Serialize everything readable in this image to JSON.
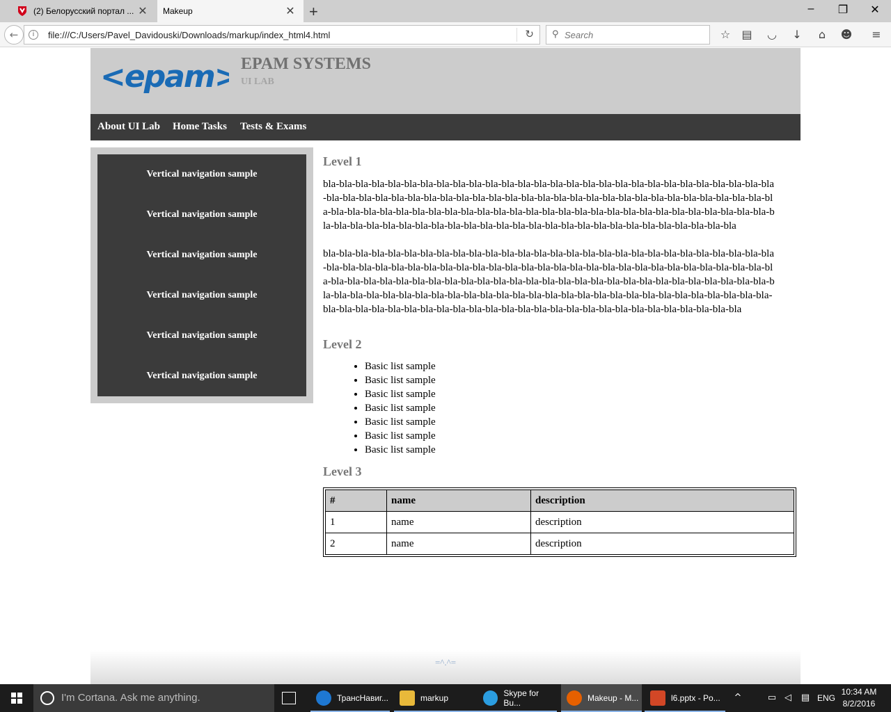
{
  "browser": {
    "tabs": [
      {
        "title": "(2) Белорусский портал ...",
        "active": false
      },
      {
        "title": "Makeup",
        "active": true
      }
    ],
    "url": "file:///C:/Users/Pavel_Davidouski/Downloads/markup/index_html4.html",
    "search_placeholder": "Search",
    "toolbar_icons": [
      "star-icon",
      "reading-list-icon",
      "pocket-icon",
      "download-icon",
      "home-icon",
      "account-icon",
      "menu-icon"
    ]
  },
  "site": {
    "logo_text": "<epam>",
    "title": "EPAM SYSTEMS",
    "subtitle": "UI LAB",
    "topnav": [
      "About UI Lab",
      "Home Tasks",
      "Tests & Exams"
    ],
    "sidebar": [
      "Vertical navigation sample",
      "Vertical navigation sample",
      "Vertical navigation sample",
      "Vertical navigation sample",
      "Vertical navigation sample",
      "Vertical navigation sample"
    ],
    "level1": "Level 1",
    "para1": "bla-bla-bla-bla-bla-bla-bla-bla-bla-bla-bla-bla-bla-bla-bla-bla-bla-bla-bla-bla-bla-bla-bla-bla-bla-bla-bla-bla-bla-bla-bla-bla-bla-bla-bla-bla-bla-bla-bla-bla-bla-bla-bla-bla-bla-bla-bla-bla-bla-bla-bla-bla-bla-bla-bla-bla-bla-bla-bla-bla-bla-bla-bla-bla-bla-bla-bla-bla-bla-bla-bla-bla-bla-bla-bla-bla-bla-bla-bla-bla-bla-bla-bla-bla-bla-bla-bla-bla-bla-bla-bla-bla-bla-bla-bla-bla-bla-bla-bla-bla-bla-bla-bla-bla-bla-bla-bla-bla-bla",
    "para2": "bla-bla-bla-bla-bla-bla-bla-bla-bla-bla-bla-bla-bla-bla-bla-bla-bla-bla-bla-bla-bla-bla-bla-bla-bla-bla-bla-bla-bla-bla-bla-bla-bla-bla-bla-bla-bla-bla-bla-bla-bla-bla-bla-bla-bla-bla-bla-bla-bla-bla-bla-bla-bla-bla-bla-bla-bla-bla-bla-bla-bla-bla-bla-bla-bla-bla-bla-bla-bla-bla-bla-bla-bla-bla-bla-bla-bla-bla-bla-bla-bla-bla-bla-bla-bla-bla-bla-bla-bla-bla-bla-bla-bla-bla-bla-bla-bla-bla-bla-bla-bla-bla-bla-bla-bla-bla-bla-bla-bla-bla-bla-bla-bla-bla-bla-bla-bla-bla-bla-bla-bla-bla-bla-bla-bla-bla-bla-bla-bla-bla-bla-bla-bla-bla-bla-bla-bla",
    "level2": "Level 2",
    "list": [
      "Basic list sample",
      "Basic list sample",
      "Basic list sample",
      "Basic list sample",
      "Basic list sample",
      "Basic list sample",
      "Basic list sample"
    ],
    "level3": "Level 3",
    "table": {
      "headers": [
        "#",
        "name",
        "description"
      ],
      "rows": [
        [
          "1",
          "name",
          "description"
        ],
        [
          "2",
          "name",
          "description"
        ]
      ]
    },
    "footer": "=^.^="
  },
  "taskbar": {
    "cortana": "I'm Cortana. Ask me anything.",
    "items": [
      {
        "label": "ТрансНавиг...",
        "icon": "edge-icon"
      },
      {
        "label": "markup",
        "icon": "folder-icon"
      },
      {
        "label": "Skype for Bu...",
        "icon": "skype-icon"
      },
      {
        "label": "Makeup - M...",
        "icon": "firefox-icon"
      },
      {
        "label": "l6.pptx - Po...",
        "icon": "powerpoint-icon"
      }
    ],
    "lang": "ENG",
    "time": "10:34 AM",
    "date": "8/2/2016"
  }
}
